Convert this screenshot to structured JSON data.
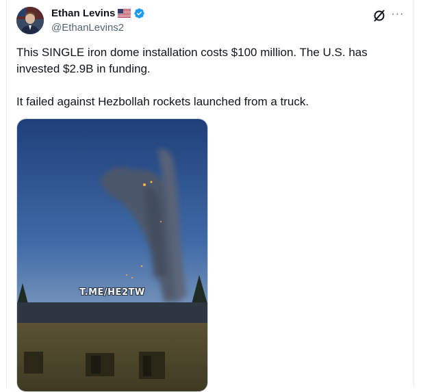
{
  "author": {
    "name": "Ethan Levins",
    "handle": "@EthanLevins2",
    "flag_icon": "us-flag-icon",
    "verified_icon": "verified-badge-icon",
    "verified_color": "#1d9bf0"
  },
  "actions": {
    "grok_icon": "grok-icon",
    "more_icon": "more-options-icon",
    "more_glyph": "···"
  },
  "tweet": {
    "paragraph1": "This SINGLE iron dome installation costs $100 million. The U.S. has invested $2.9B in funding.",
    "paragraph2": "It failed against Hezbollah rockets launched from a truck."
  },
  "media": {
    "watermark": "T.ME/HE2TW"
  }
}
